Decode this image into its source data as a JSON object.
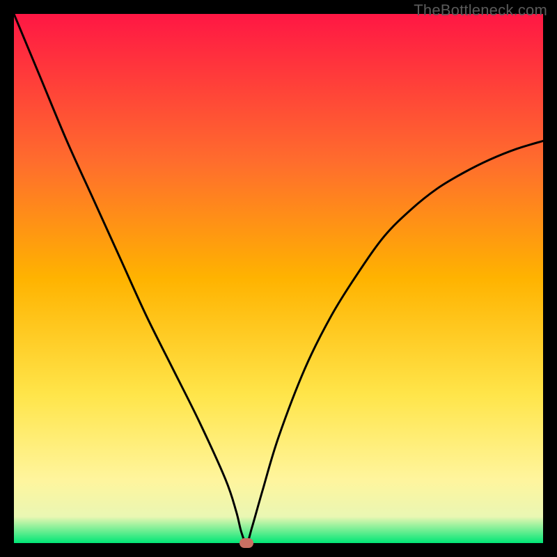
{
  "watermark": "TheBottleneck.com",
  "chart_data": {
    "type": "line",
    "title": "",
    "xlabel": "",
    "ylabel": "",
    "xlim": [
      0,
      100
    ],
    "ylim": [
      0,
      100
    ],
    "background_gradient": {
      "top": "#ff1744",
      "mid1": "#ff6d2d",
      "mid2": "#ffb300",
      "mid3": "#ffe54a",
      "mid4": "#fff59d",
      "bottom_band": "#eaf7b3",
      "bottom": "#00e676"
    },
    "series": [
      {
        "name": "bottleneck-curve",
        "x": [
          0,
          5,
          10,
          15,
          20,
          25,
          30,
          35,
          40,
          42,
          43,
          44,
          45,
          47,
          50,
          55,
          60,
          65,
          70,
          75,
          80,
          85,
          90,
          95,
          100
        ],
        "y": [
          100,
          88,
          76,
          65,
          54,
          43,
          33,
          23,
          12,
          6,
          2,
          0,
          3,
          10,
          20,
          33,
          43,
          51,
          58,
          63,
          67,
          70,
          72.5,
          74.5,
          76
        ]
      }
    ],
    "optimal_marker": {
      "x": 44,
      "y": 0,
      "color": "#c96f63"
    },
    "notes": "V-shaped bottleneck curve on rainbow gradient; minimum near x≈44."
  }
}
